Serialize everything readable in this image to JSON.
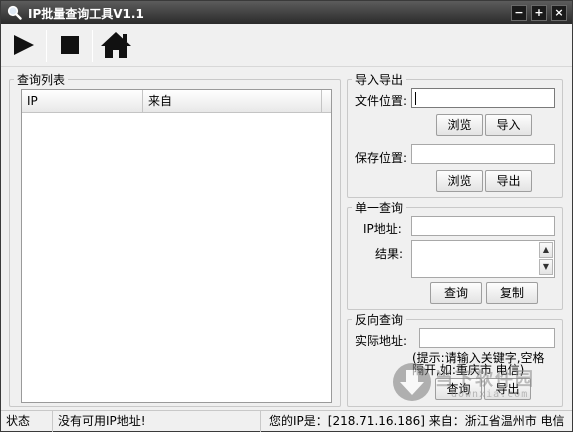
{
  "titlebar": {
    "title": "IP批量查询工具V1.1",
    "minimize": "−",
    "maximize": "+",
    "close": "×"
  },
  "toolbar": {
    "icons": [
      "play-icon",
      "stop-icon",
      "home-icon"
    ]
  },
  "query_list": {
    "group_title": "查询列表",
    "columns": [
      "IP",
      "来自",
      ""
    ]
  },
  "import_export": {
    "group_title": "导入导出",
    "file_location_label": "文件位置:",
    "file_location_value": "",
    "browse_label": "浏览",
    "import_label": "导入",
    "save_location_label": "保存位置:",
    "save_location_value": "",
    "browse2_label": "浏览",
    "export_label": "导出"
  },
  "single_query": {
    "group_title": "单一查询",
    "ip_label": "IP地址:",
    "ip_value": "",
    "result_label": "结果:",
    "result_value": "",
    "query_label": "查询",
    "copy_label": "复制"
  },
  "reverse_query": {
    "group_title": "反向查询",
    "address_label": "实际地址:",
    "address_value": "",
    "hint_line1": "(提示:请输入关键字,空格",
    "hint_line2": "隔开,如:重庆市 电信)",
    "query_label": "查询",
    "export_label": "导出"
  },
  "statusbar": {
    "status_label": "状态",
    "status_message": "没有可用IP地址!",
    "your_ip": "您的IP是：[218.71.16.186] 来自：浙江省温州市 电信"
  },
  "watermark": {
    "text": "当下软件园",
    "sub": "downxia.com"
  },
  "colors": {
    "titlebar_top": "#5c5c5c",
    "titlebar_bottom": "#2b2b2b",
    "window_bg": "#f0f0f0"
  }
}
